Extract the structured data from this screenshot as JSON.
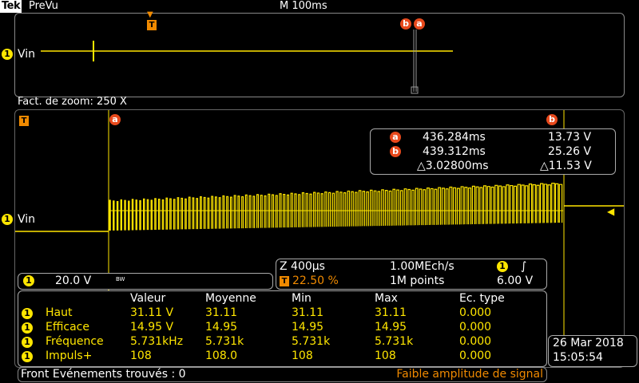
{
  "header": {
    "brand": "Tek",
    "mode": "PreVu",
    "timebase": "M 100ms"
  },
  "overview": {
    "channel": "1",
    "label": "Vin",
    "trigger_marker": "T",
    "cursor_b": "b",
    "cursor_a": "a"
  },
  "zoom": {
    "label": "Fact. de zoom: 250 X"
  },
  "main": {
    "channel": "1",
    "label": "Vin",
    "trigger_marker": "T",
    "cursor_a": "a"
  },
  "cursors": {
    "a_label": "a",
    "b_label": "b",
    "a_time": "436.284ms",
    "a_volt": "13.73 V",
    "b_time": "439.312ms",
    "b_volt": "25.26 V",
    "delta_time": "△3.02800ms",
    "delta_volt": "△11.53 V"
  },
  "channel_info": {
    "channel": "1",
    "scale": "20.0 V",
    "bw": "BW"
  },
  "horizontal": {
    "scale": "Z 400µs",
    "sample_rate": "1.00MEch/s",
    "trigger_pos": "22.50 %",
    "record_length": "1M points",
    "trigger_channel": "1",
    "trigger_slope": "∫",
    "trigger_level": "6.00 V"
  },
  "measurements": {
    "headers": [
      "Valeur",
      "Moyenne",
      "Min",
      "Max",
      "Ec. type"
    ],
    "rows": [
      {
        "ch": "1",
        "name": "Haut",
        "values": [
          "31.11 V",
          "31.11",
          "31.11",
          "31.11",
          "0.000"
        ]
      },
      {
        "ch": "1",
        "name": "Efficace",
        "values": [
          "14.95 V",
          "14.95",
          "14.95",
          "14.95",
          "0.000"
        ]
      },
      {
        "ch": "1",
        "name": "Fréquence",
        "values": [
          "5.731kHz",
          "5.731k",
          "5.731k",
          "5.731k",
          "0.000"
        ]
      },
      {
        "ch": "1",
        "name": "Impuls+",
        "values": [
          "108",
          "108.0",
          "108",
          "108",
          "0.000"
        ]
      }
    ]
  },
  "status": {
    "left": "Front Evénements trouvés  : 0",
    "right": "Faible amplitude de signal"
  },
  "datetime": {
    "date": "26 Mar 2018",
    "time": "15:05:54"
  },
  "colors": {
    "trace": "#ffe600",
    "cursor_marker": "#e8491c",
    "trigger": "#f08a00",
    "grid": "#555555"
  }
}
